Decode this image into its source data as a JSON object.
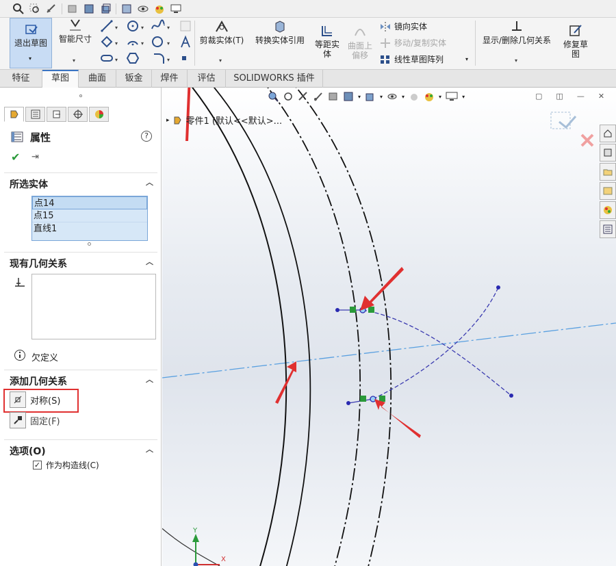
{
  "ribbon": {
    "exit_sketch": "退出草图",
    "smart_dimension": "智能尺寸",
    "trim_entities": "剪裁实体(T)",
    "convert_entities": "转换实体引用",
    "offset_entities_1": "等距实",
    "offset_entities_2": "体",
    "offset_on_surface_1": "曲面上",
    "offset_on_surface_2": "偏移",
    "mirror_entities": "镜向实体",
    "move_copy_entities": "移动/复制实体",
    "linear_pattern": "线性草图阵列",
    "display_delete_relations": "显示/删除几何关系",
    "repair_sketch_1": "修复草",
    "repair_sketch_2": "图"
  },
  "tabs": [
    {
      "label": "特征"
    },
    {
      "label": "草图"
    },
    {
      "label": "曲面"
    },
    {
      "label": "钣金"
    },
    {
      "label": "焊件"
    },
    {
      "label": "评估"
    },
    {
      "label": "SOLIDWORKS 插件"
    }
  ],
  "panel": {
    "title": "属性",
    "help": "?",
    "selected_entities": {
      "heading": "所选实体",
      "items": [
        "点14",
        "点15",
        "直线1"
      ]
    },
    "existing_relations": {
      "heading": "现有几何关系",
      "status": "欠定义"
    },
    "add_relations": {
      "heading": "添加几何关系",
      "symmetric": "对称(S)",
      "fixed": "固定(F)"
    },
    "options": {
      "heading": "选项(O)",
      "construction": "作为构造线(C)",
      "construction_checked": true
    }
  },
  "graphics": {
    "tree_root": "零件1 (默认<<默认>...",
    "axis_y": "Y",
    "axis_x": "X"
  },
  "colors": {
    "accent": "#3a74c4",
    "highlight_red": "#e03030",
    "sketch_blue": "#3b3bb0",
    "centerline": "#5aa0e0",
    "relation_green": "#2a9a3a"
  }
}
